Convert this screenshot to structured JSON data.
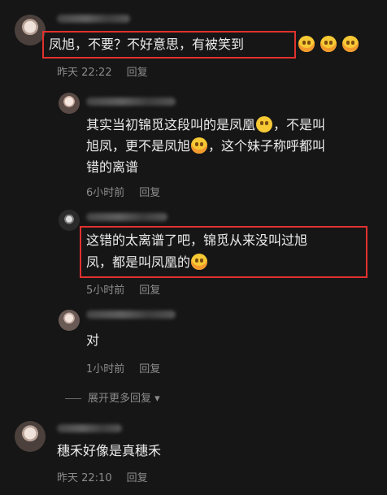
{
  "comments": [
    {
      "text": "凤旭，不要？不好意思，有被笑到",
      "time": "昨天 22:22",
      "reply": "回复"
    },
    {
      "line1": "其实当初锦觅这段叫的是凤凰",
      "line1b": "，不是叫",
      "line2": "旭凤，更不是凤旭",
      "line2b": "，这个妹子称呼都叫",
      "line3": "错的离谱",
      "time": "6小时前",
      "reply": "回复"
    },
    {
      "line1": "这错的太离谱了吧，锦觅从来没叫过旭",
      "line2": "凤，都是叫凤凰的",
      "time": "5小时前",
      "reply": "回复"
    },
    {
      "text": "对",
      "time": "1小时前",
      "reply": "回复"
    },
    {
      "text": "穗禾好像是真穗禾",
      "time": "昨天 22:10",
      "reply": "回复"
    }
  ],
  "expand_more": "展开更多回复",
  "icons": {
    "emoji_tears": "laughing-tears-emoji-icon",
    "emoji_pleading": "pleading-face-emoji-icon",
    "emoji_rofl": "rolling-laughing-emoji-icon",
    "chevron": "chevron-down-icon"
  },
  "colors": {
    "background": "#161616",
    "highlight": "#e0312f",
    "meta": "#8c8c8c"
  }
}
